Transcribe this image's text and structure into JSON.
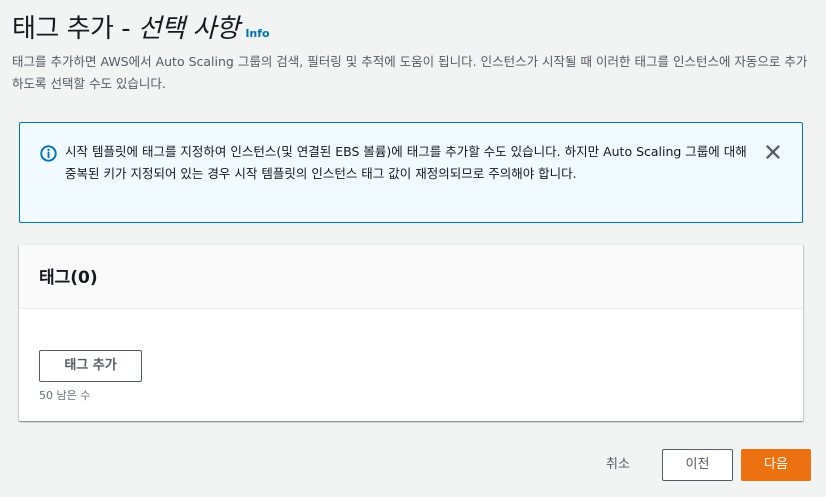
{
  "header": {
    "title_main": "태그 추가 - ",
    "title_optional": "선택 사항",
    "info_label": "Info",
    "description": "태그를 추가하면 AWS에서 Auto Scaling 그룹의 검색, 필터링 및 추적에 도움이 됩니다. 인스턴스가 시작될 때 이러한 태그를 인스턴스에 자동으로 추가하도록 선택할 수도 있습니다."
  },
  "alert": {
    "icon": "info-circle-icon",
    "text": "시작 템플릿에 태그를 지정하여 인스턴스(및 연결된 EBS 볼륨)에 태그를 추가할 수도 있습니다. 하지만 Auto Scaling 그룹에 대해 중복된 키가 지정되어 있는 경우 시작 템플릿의 인스턴스 태그 값이 재정의되므로 주의해야 합니다.",
    "close_icon": "close-icon",
    "color": "#0073bb"
  },
  "tags_panel": {
    "title": "태그(0)",
    "add_button_label": "태그 추가",
    "remaining_text": "50 남은 수"
  },
  "footer": {
    "cancel_label": "취소",
    "prev_label": "이전",
    "next_label": "다음",
    "primary_color": "#ec7211"
  }
}
